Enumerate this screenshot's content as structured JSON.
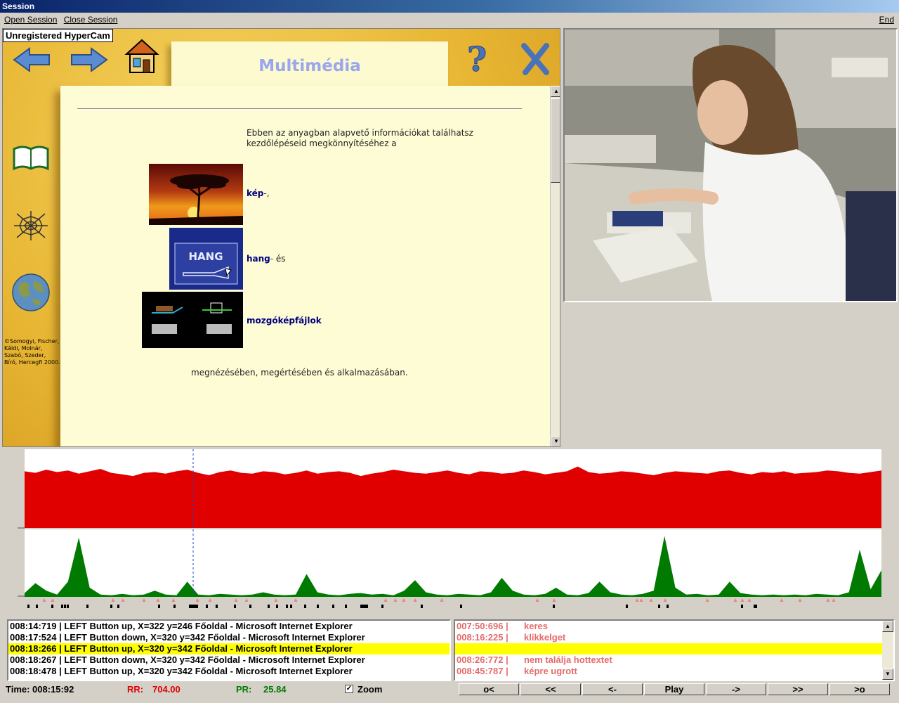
{
  "window": {
    "title": "Session"
  },
  "menu": {
    "open_session": "Open Session",
    "close_session": "Close Session",
    "end": "End"
  },
  "webpage": {
    "watermark": "Unregistered HyperCam",
    "title": "Multimédia",
    "intro": "Ebben az anyagban alapvető információkat találhatsz kezdőlépéseid megkönnyítéséhez a",
    "links": [
      {
        "label": "kép",
        "suffix": "-,"
      },
      {
        "label": "hang",
        "suffix": "- és"
      },
      {
        "label": "mozgóképfájlok",
        "suffix": ""
      }
    ],
    "image_label_hang": "HANG",
    "outro": "megnézésében, megértésében és alkalmazásában.",
    "copyright": "©Somogyi, Fischer, Káldi, Molnár, Szabó, Szeder, Bíró, Hercegfi 2000."
  },
  "log_left": [
    {
      "text": "008:14:719 |  LEFT Button up, X=322 y=246    Főoldal - Microsoft Internet Explorer",
      "highlight": false
    },
    {
      "text": "008:17:524 |  LEFT Button down, X=320 y=342    Főoldal - Microsoft Internet Explorer",
      "highlight": false
    },
    {
      "text": "008:18:266 |  LEFT Button up, X=320 y=342    Főoldal - Microsoft Internet Explorer",
      "highlight": true
    },
    {
      "text": "008:18:267 |  LEFT Button down, X=320 y=342    Főoldal - Microsoft Internet Explorer",
      "highlight": false
    },
    {
      "text": "008:18:478 |  LEFT Button up, X=320 y=342    Főoldal - Microsoft Internet Explorer",
      "highlight": false
    }
  ],
  "log_right": [
    {
      "time": "007:50:696 |",
      "text": "keres"
    },
    {
      "time": "008:16:225 |",
      "text": "klikkelget"
    },
    {
      "time": "",
      "text": ""
    },
    {
      "time": "008:26:772 |",
      "text": "nem találja hottextet"
    },
    {
      "time": "008:45:787 |",
      "text": "képre ugrott"
    }
  ],
  "status": {
    "time_label": "Time: 008:15:92",
    "rr_label": "RR:",
    "rr_value": "704.00",
    "pr_label": "PR:",
    "pr_value": "25.84",
    "zoom_label": "Zoom",
    "zoom_checked": "✓"
  },
  "playback": {
    "buttons": [
      "o<",
      "<<",
      "<-",
      "Play",
      "->",
      ">>",
      ">o"
    ]
  },
  "colors": {
    "rr": "#e00000",
    "pr": "#007a00",
    "highlight": "#ffff00",
    "annotation": "#e56a6a"
  },
  "chart_data": {
    "type": "area",
    "series": [
      {
        "values": [
          72,
          70,
          74,
          71,
          73,
          69,
          72,
          75,
          70,
          68,
          66,
          70,
          71,
          69,
          72,
          74,
          70,
          67,
          71,
          73,
          70,
          69,
          72,
          71,
          68,
          70,
          73,
          69,
          71,
          72,
          70,
          66,
          69,
          71,
          74,
          72,
          70,
          69,
          71,
          73,
          70,
          68,
          72,
          71,
          69,
          70,
          73,
          71,
          68,
          70,
          72,
          78,
          71,
          69,
          70,
          72,
          71,
          69,
          67,
          70,
          72,
          71,
          70,
          69,
          72,
          73,
          70,
          68,
          71,
          70,
          72,
          69,
          70,
          71,
          73,
          72,
          70,
          69,
          71,
          73
        ]
      },
      {
        "values": [
          5,
          18,
          8,
          3,
          20,
          78,
          12,
          3,
          2,
          4,
          2,
          3,
          8,
          3,
          2,
          20,
          3,
          2,
          4,
          3,
          2,
          3,
          6,
          3,
          2,
          3,
          30,
          6,
          3,
          2,
          4,
          5,
          3,
          4,
          2,
          8,
          22,
          6,
          3,
          2,
          4,
          3,
          2,
          6,
          25,
          8,
          3,
          2,
          4,
          12,
          3,
          2,
          5,
          20,
          6,
          3,
          2,
          4,
          8,
          80,
          12,
          3,
          4,
          2,
          3,
          20,
          5,
          3,
          2,
          3,
          2,
          3,
          2,
          4,
          3,
          2,
          6,
          62,
          10,
          35
        ]
      }
    ],
    "event_markers": "triangles and ticks along baseline",
    "grid": false
  }
}
